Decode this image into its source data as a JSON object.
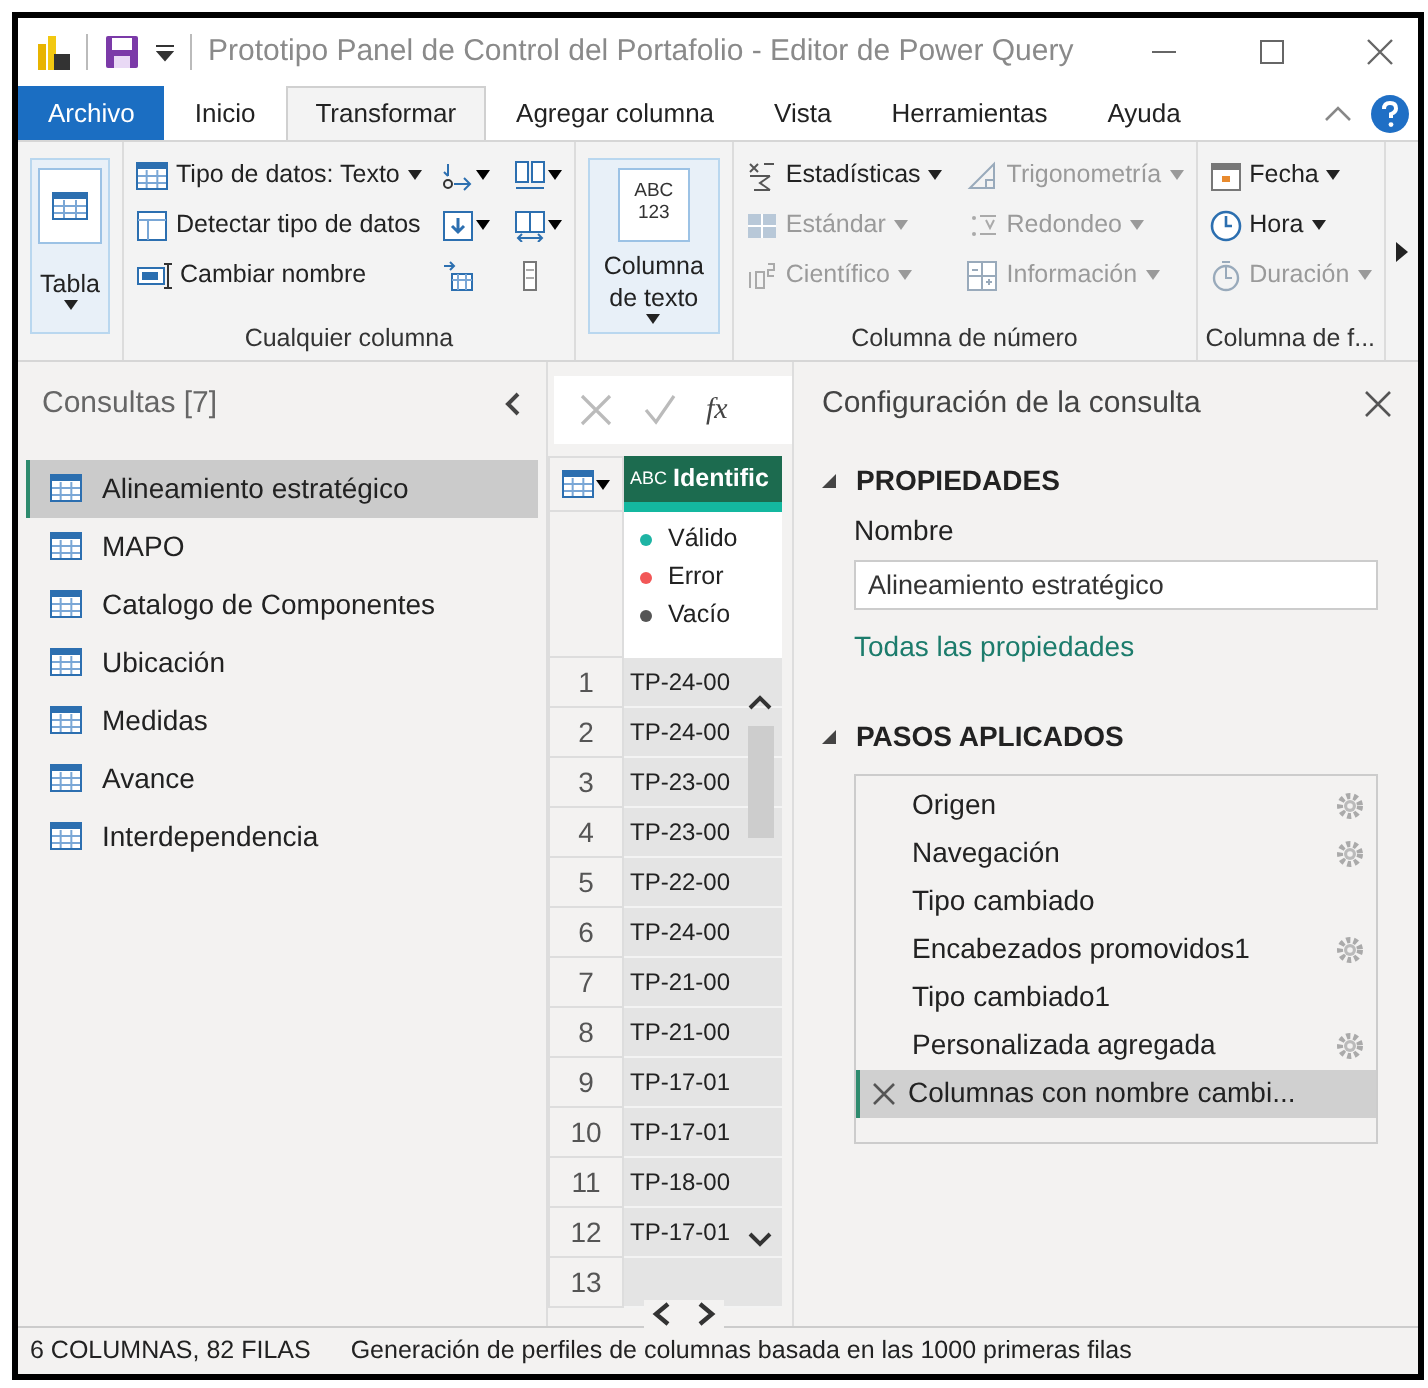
{
  "window": {
    "title": "Prototipo Panel de Control del Portafolio - Editor de Power Query"
  },
  "ribbon_tabs": [
    {
      "label": "Archivo",
      "kind": "file",
      "selected": false
    },
    {
      "label": "Inicio",
      "kind": "tab",
      "selected": false
    },
    {
      "label": "Transformar",
      "kind": "tab",
      "selected": true
    },
    {
      "label": "Agregar columna",
      "kind": "tab",
      "selected": false
    },
    {
      "label": "Vista",
      "kind": "tab",
      "selected": false
    },
    {
      "label": "Herramientas",
      "kind": "tab",
      "selected": false
    },
    {
      "label": "Ayuda",
      "kind": "tab",
      "selected": false
    }
  ],
  "ribbon_groups": [
    {
      "items": [
        {
          "kind": "large",
          "label": "Tabla",
          "dropdown": true
        }
      ]
    },
    {
      "label": "Cualquier columna",
      "items": [
        {
          "kind": "small",
          "label": "Tipo de datos: Texto",
          "dropdown": true
        },
        {
          "kind": "small",
          "label": "Detectar tipo de datos",
          "dropdown": false
        },
        {
          "kind": "small",
          "label": "Cambiar nombre",
          "dropdown": false
        },
        {
          "kind": "icon",
          "dropdown": true
        },
        {
          "kind": "icon",
          "dropdown": true
        },
        {
          "kind": "icon",
          "dropdown": false
        },
        {
          "kind": "icon",
          "dropdown": true
        },
        {
          "kind": "icon",
          "dropdown": true
        },
        {
          "kind": "icon",
          "dropdown": false
        }
      ]
    },
    {
      "items": [
        {
          "kind": "large",
          "label": "Columna de texto",
          "dropdown": true,
          "icon_text": [
            "ABC",
            "123"
          ]
        }
      ]
    },
    {
      "label": "Columna de número",
      "items": [
        {
          "kind": "small",
          "label": "Estadísticas",
          "dropdown": true,
          "disabled": false
        },
        {
          "kind": "small",
          "label": "Estándar",
          "dropdown": true,
          "disabled": true
        },
        {
          "kind": "small",
          "label": "Científico",
          "dropdown": true,
          "disabled": true
        },
        {
          "kind": "small",
          "label": "Trigonometría",
          "dropdown": true,
          "disabled": true
        },
        {
          "kind": "small",
          "label": "Redondeo",
          "dropdown": true,
          "disabled": true
        },
        {
          "kind": "small",
          "label": "Información",
          "dropdown": true,
          "disabled": true
        }
      ]
    },
    {
      "label": "Columna de f...",
      "items": [
        {
          "kind": "small",
          "label": "Fecha",
          "dropdown": true,
          "disabled": false
        },
        {
          "kind": "small",
          "label": "Hora",
          "dropdown": true,
          "disabled": false
        },
        {
          "kind": "small",
          "label": "Duración",
          "dropdown": true,
          "disabled": true
        }
      ]
    }
  ],
  "queries": {
    "title": "Consultas [7]",
    "items": [
      {
        "label": "Alineamiento estratégico",
        "selected": true
      },
      {
        "label": "MAPO",
        "selected": false
      },
      {
        "label": "Catalogo de Componentes",
        "selected": false
      },
      {
        "label": "Ubicación",
        "selected": false
      },
      {
        "label": "Medidas",
        "selected": false
      },
      {
        "label": "Avance",
        "selected": false
      },
      {
        "label": "Interdependencia",
        "selected": false
      }
    ]
  },
  "formula_bar": {
    "fx": "fx"
  },
  "grid": {
    "column": {
      "type_icon": "ABC",
      "header": "Identific"
    },
    "quality": [
      {
        "label": "Válido",
        "color": "#1eb4a4"
      },
      {
        "label": "Error",
        "color": "#f25757"
      },
      {
        "label": "Vacío",
        "color": "#555555"
      }
    ],
    "rows": [
      {
        "number": "1",
        "value": "TP-24-00"
      },
      {
        "number": "2",
        "value": "TP-24-00"
      },
      {
        "number": "3",
        "value": "TP-23-00"
      },
      {
        "number": "4",
        "value": "TP-23-00"
      },
      {
        "number": "5",
        "value": "TP-22-00"
      },
      {
        "number": "6",
        "value": "TP-24-00"
      },
      {
        "number": "7",
        "value": "TP-21-00"
      },
      {
        "number": "8",
        "value": "TP-21-00"
      },
      {
        "number": "9",
        "value": "TP-17-01"
      },
      {
        "number": "10",
        "value": "TP-17-01"
      },
      {
        "number": "11",
        "value": "TP-18-00"
      },
      {
        "number": "12",
        "value": "TP-17-01"
      },
      {
        "number": "13"
      }
    ]
  },
  "settings": {
    "title": "Configuración de la consulta",
    "properties_heading": "PROPIEDADES",
    "name_label": "Nombre",
    "name_value": "Alineamiento estratégico",
    "all_properties_link": "Todas las propiedades",
    "steps_heading": "PASOS APLICADOS",
    "steps": [
      {
        "label": "Origen",
        "settings": true,
        "selected": false
      },
      {
        "label": "Navegación",
        "settings": true,
        "selected": false
      },
      {
        "label": "Tipo cambiado",
        "settings": false,
        "selected": false
      },
      {
        "label": "Encabezados promovidos1",
        "settings": true,
        "selected": false
      },
      {
        "label": "Tipo cambiado1",
        "settings": false,
        "selected": false
      },
      {
        "label": "Personalizada agregada",
        "settings": true,
        "selected": false
      },
      {
        "label": "Columnas con nombre cambi...",
        "settings": false,
        "selected": true
      }
    ]
  },
  "status_bar": {
    "counts": "6 COLUMNAS, 82 FILAS",
    "profiling": "Generación de perfiles de columnas basada en las 1000 primeras filas"
  }
}
